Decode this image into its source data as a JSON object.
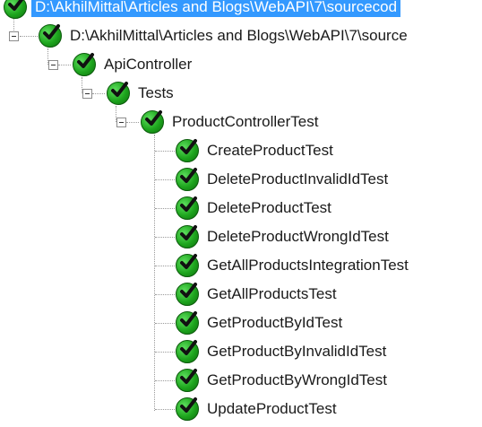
{
  "tree": {
    "root_selected": {
      "label": "D:\\AkhilMittal\\Articles and Blogs\\WebAPI\\7\\sourcecod"
    },
    "root": {
      "label": "D:\\AkhilMittal\\Articles and Blogs\\WebAPI\\7\\source"
    },
    "project": {
      "label": "ApiController"
    },
    "namespace": {
      "label": "Tests"
    },
    "fixture": {
      "label": "ProductControllerTest"
    },
    "tests": [
      {
        "label": "CreateProductTest"
      },
      {
        "label": "DeleteProductInvalidIdTest"
      },
      {
        "label": "DeleteProductTest"
      },
      {
        "label": "DeleteProductWrongIdTest"
      },
      {
        "label": "GetAllProductsIntegrationTest"
      },
      {
        "label": "GetAllProductsTest"
      },
      {
        "label": "GetProductByIdTest"
      },
      {
        "label": "GetProductByInvalidIdTest"
      },
      {
        "label": "GetProductByWrongIdTest"
      },
      {
        "label": "UpdateProductTest"
      }
    ]
  },
  "colors": {
    "selection": "#3399ff",
    "pass_green": "#1da41d"
  },
  "icons": {
    "status": "check-passed-icon",
    "expander": "collapse-icon"
  }
}
